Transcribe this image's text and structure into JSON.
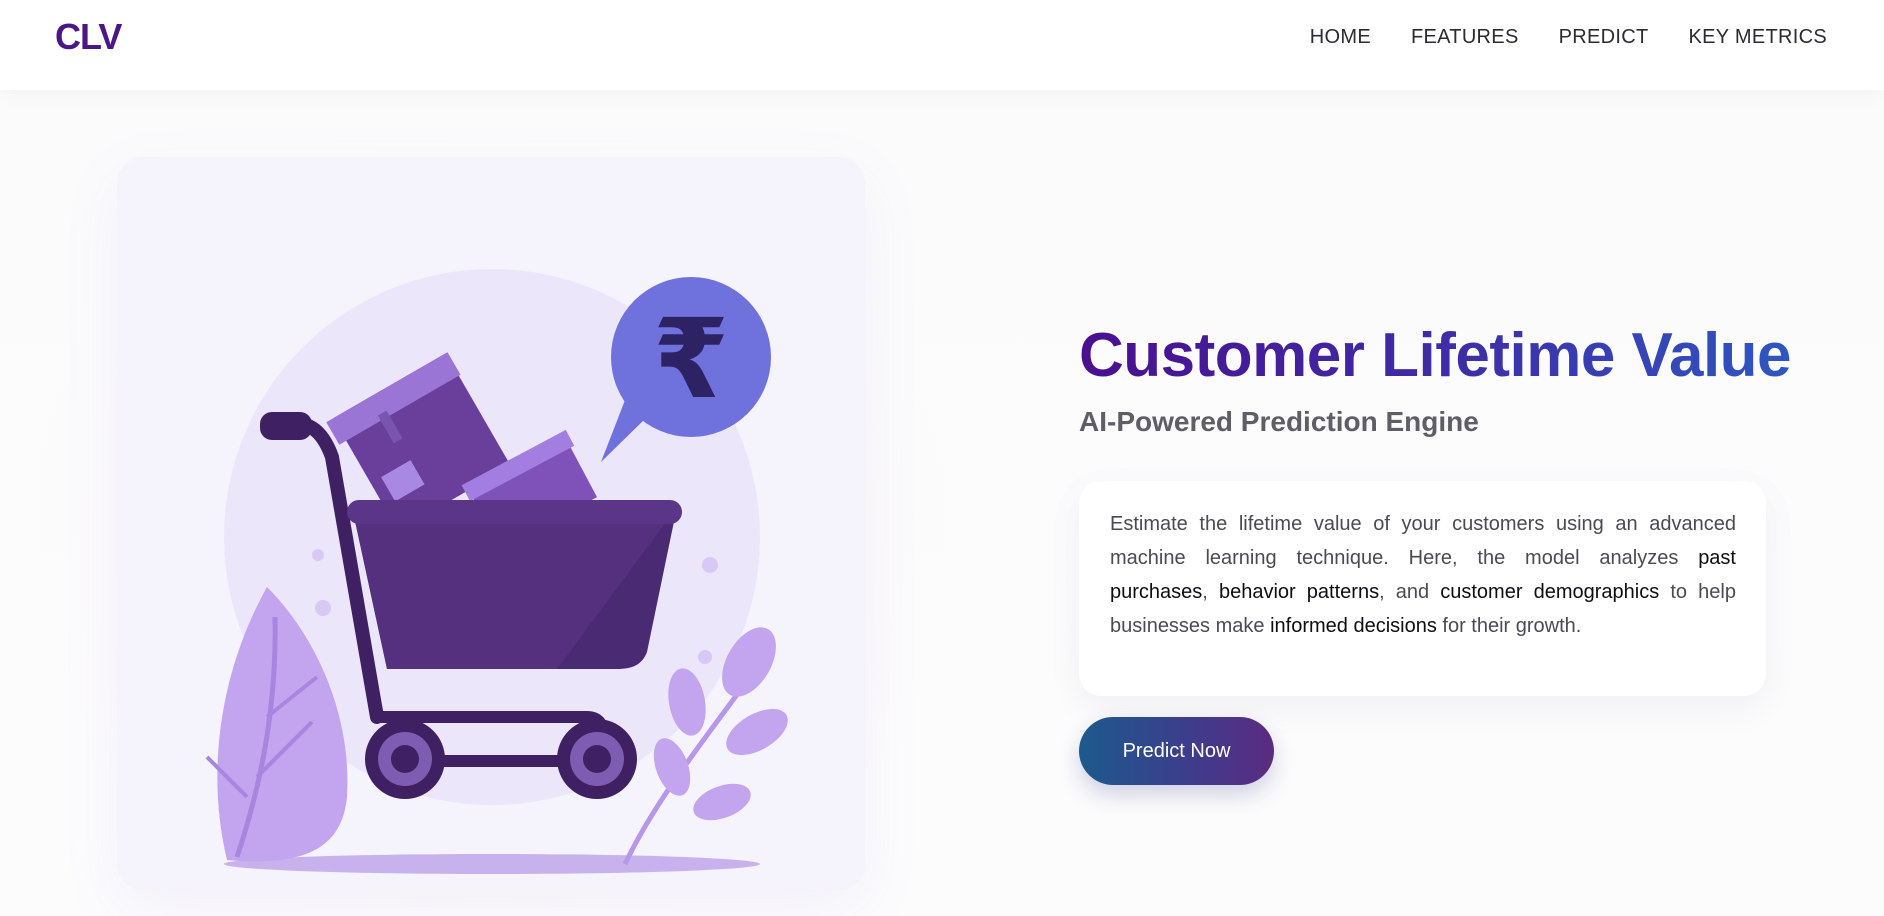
{
  "brand": {
    "logo": "CLV"
  },
  "nav": {
    "items": [
      {
        "label": "HOME"
      },
      {
        "label": "FEATURES"
      },
      {
        "label": "PREDICT"
      },
      {
        "label": "KEY METRICS"
      }
    ]
  },
  "hero": {
    "title": "Customer Lifetime Value",
    "subtitle": "AI-Powered Prediction Engine",
    "description": {
      "p1": "Estimate the lifetime value of your customers using an advanced machine learning technique. Here, the model analyzes ",
      "k1": "past purchases",
      "p2": ", ",
      "k2": "behavior patterns",
      "p3": ", and ",
      "k3": "customer demographics",
      "p4": " to help businesses make ",
      "k4": "informed decisions",
      "p5": " for their growth."
    },
    "cta_label": "Predict Now",
    "illustration": {
      "currency_symbol": "₹",
      "icons": [
        "shopping-cart-icon",
        "rupee-speech-bubble-icon",
        "leaf-icon"
      ]
    }
  },
  "colors": {
    "brand": "#4b1787",
    "title_gradient_start": "#4a0f8e",
    "title_gradient_end": "#2f56c0",
    "button_gradient_start": "#1c5a8c",
    "button_gradient_end": "#5b2b80"
  }
}
